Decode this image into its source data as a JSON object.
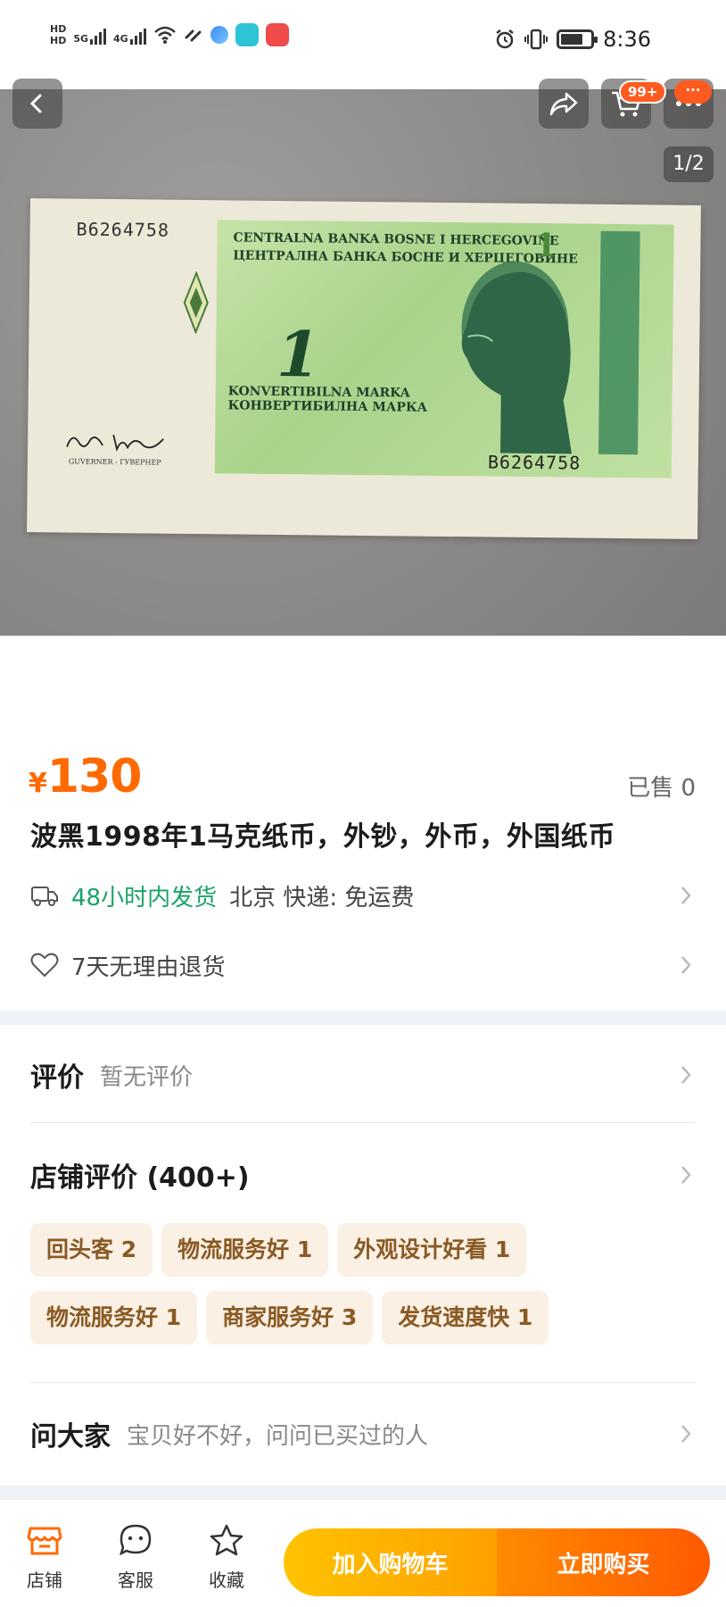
{
  "status_bar": {
    "hd1": "HD",
    "hd2": "HD",
    "net1": "5G",
    "net2": "4G",
    "time": "8:36"
  },
  "gallery": {
    "page_indicator": "1/2",
    "cart_badge": "99+",
    "more_badge": "···"
  },
  "banknote": {
    "serial": "B6264758",
    "bank_line1": "CENTRALNA BANKA BOSNE I HERCEGOVINE",
    "bank_line2": "ЦЕНТРАЛНА БАНКА БОСНЕ И ХЕРЦЕГОВИНЕ",
    "denomination": "1",
    "currency_line1": "KONVERTIBILNA MARKA",
    "currency_line2": "КОНВЕРТИБИЛНА МАРКА",
    "governor": "GUVERNER - ГУВЕРНЕР"
  },
  "product": {
    "currency_symbol": "¥",
    "price": "130",
    "sold": "已售 0",
    "title": "波黑1998年1马克纸币，外钞，外币，外国纸币"
  },
  "shipping": {
    "fast": "48小时内发货",
    "details": "北京  快递: 免运费"
  },
  "returns": {
    "label": "7天无理由退货"
  },
  "review": {
    "label": "评价",
    "sub": "暂无评价"
  },
  "store_review": {
    "label": "店铺评价 (400+)",
    "tags": [
      "回头客 2",
      "物流服务好 1",
      "外观设计好看 1",
      "物流服务好 1",
      "商家服务好 3",
      "发货速度快 1"
    ]
  },
  "ask": {
    "label": "问大家",
    "sub": "宝贝好不好，问问已买过的人"
  },
  "bottom_bar": {
    "store": "店铺",
    "service": "客服",
    "favorite": "收藏",
    "add_to_cart": "加入购物车",
    "buy_now": "立即购买"
  },
  "colors": {
    "accent": "#ff6a00",
    "ship_green": "#19a366",
    "tag_bg": "#fbf0e4",
    "tag_text": "#8a5a24"
  }
}
